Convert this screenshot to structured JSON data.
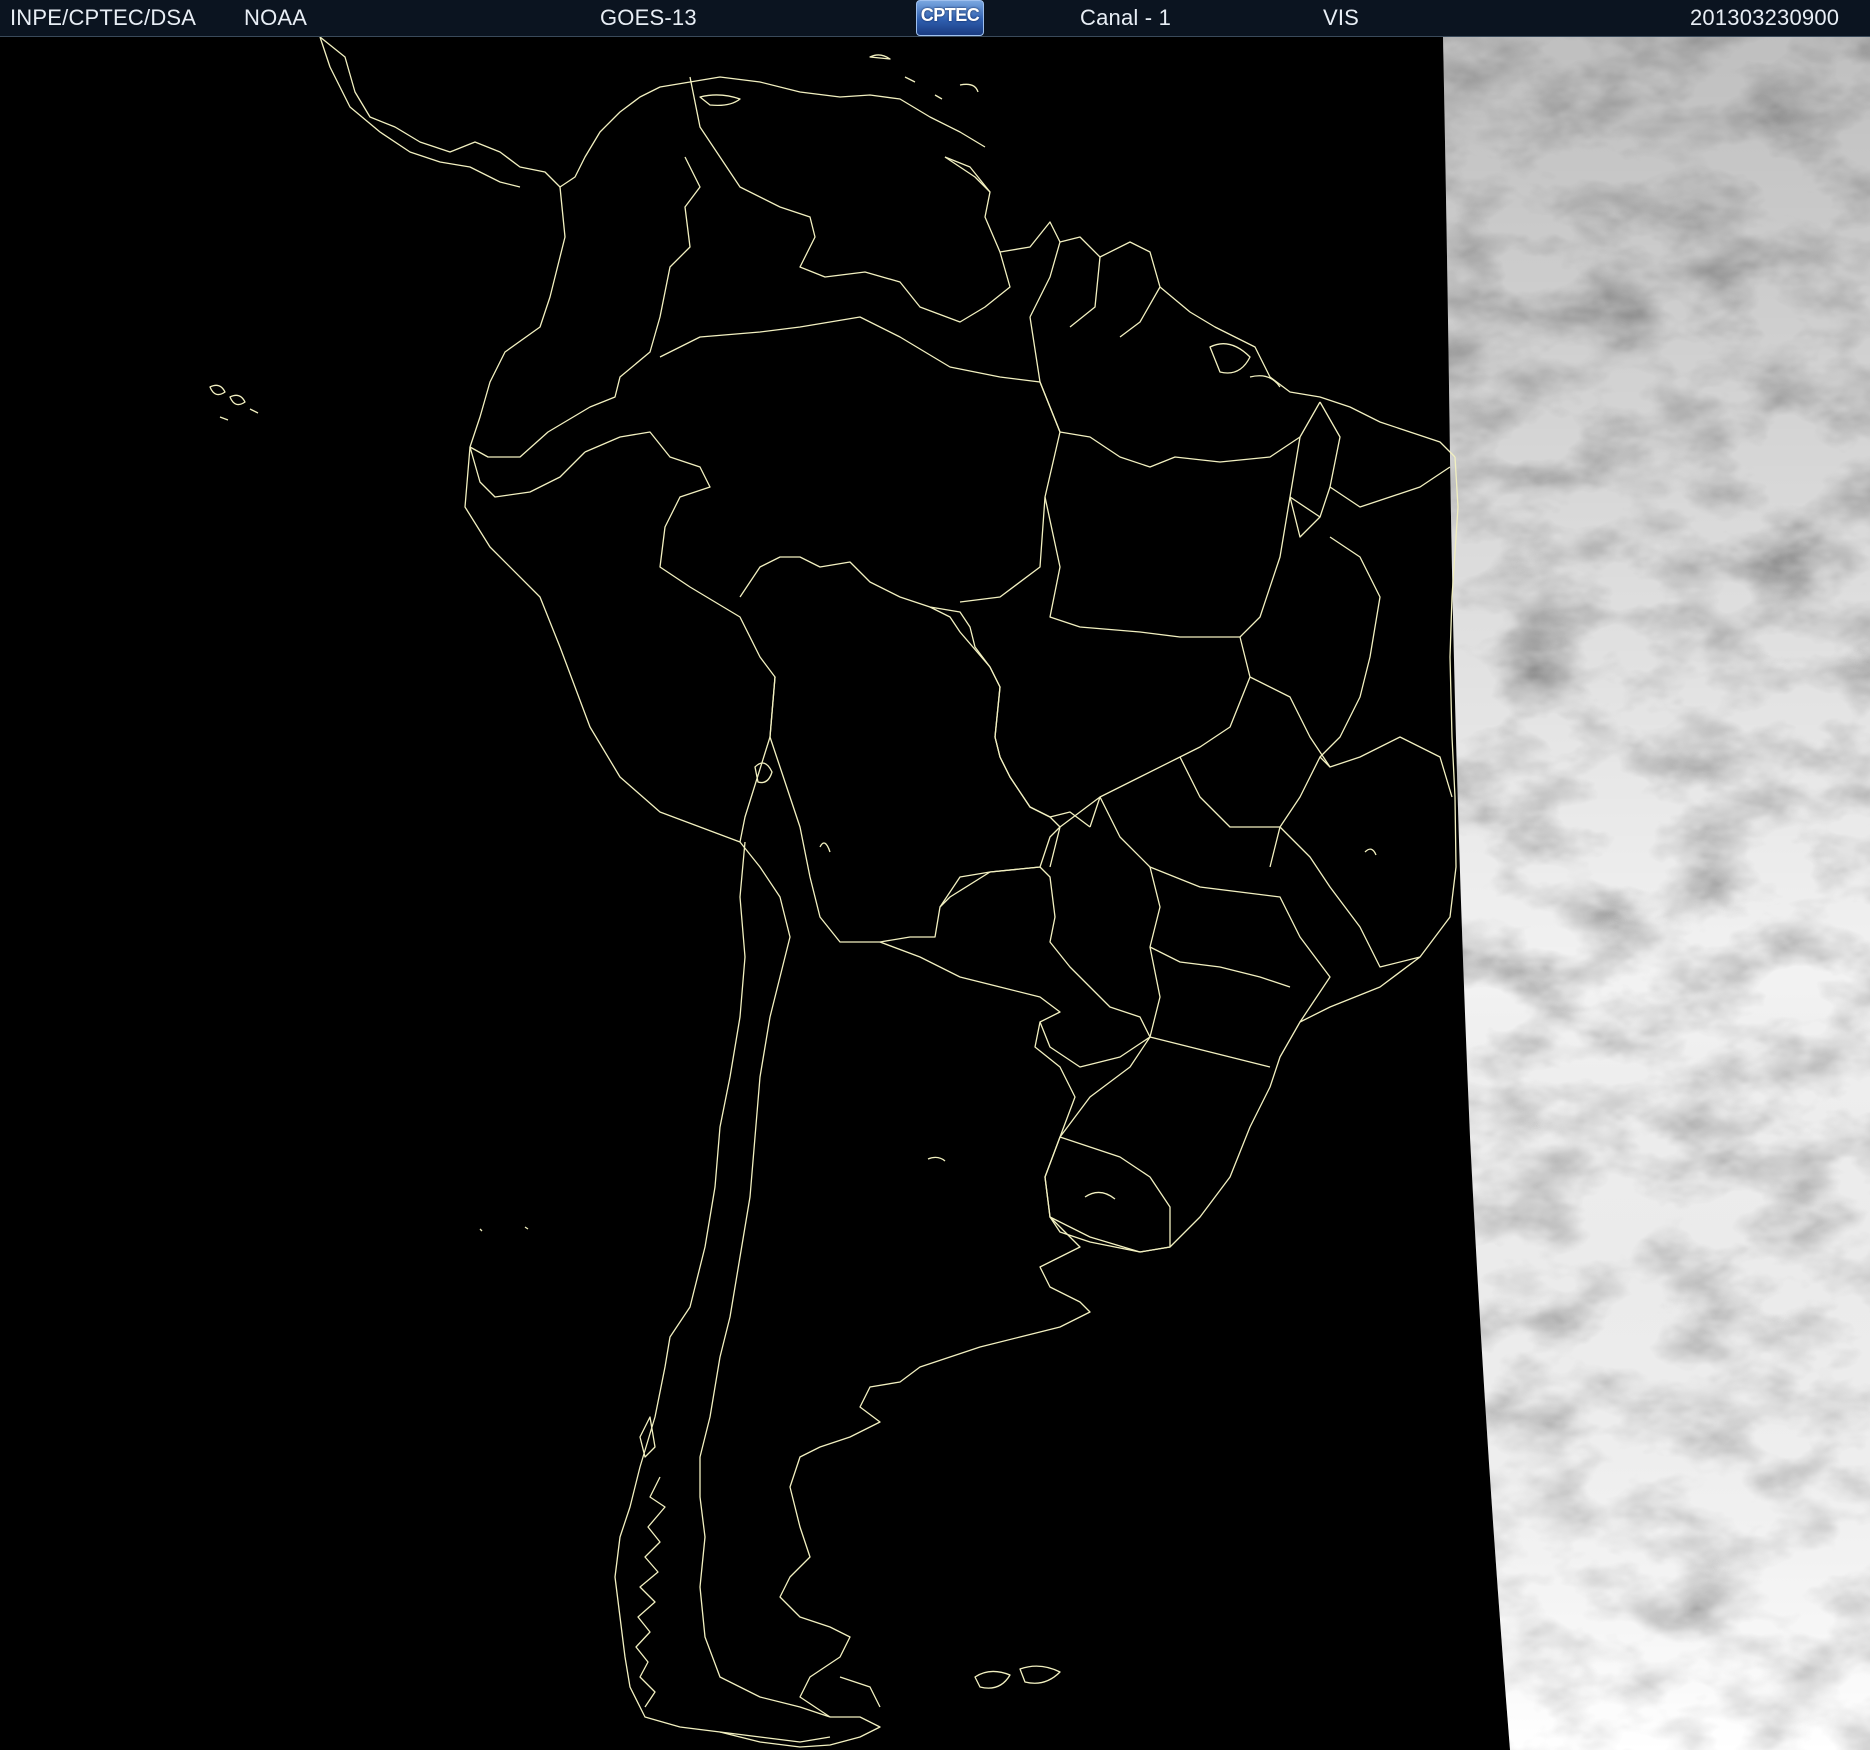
{
  "header": {
    "agency": "INPE/CPTEC/DSA",
    "partner": "NOAA",
    "satellite": "GOES-13",
    "logo_text": "CPTEC",
    "channel": "Canal - 1",
    "band": "VIS",
    "timestamp": "201303230900"
  },
  "map": {
    "region": "South America",
    "background_color": "#000000",
    "border_color": "#f2f0c0",
    "cloud_color": "#d8d8d8"
  },
  "colors": {
    "header_bg": "#0b1420",
    "header_text": "#e8eef5",
    "logo_blue": "#2f5fb0"
  }
}
